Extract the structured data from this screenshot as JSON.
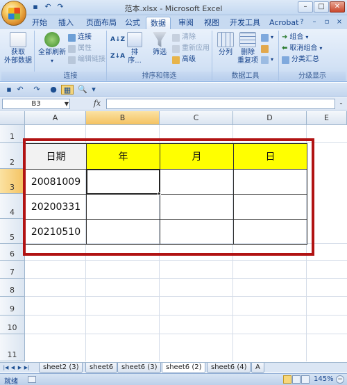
{
  "title": "范本.xlsx - Microsoft Excel",
  "ribbon_tabs": [
    "开始",
    "插入",
    "页面布局",
    "公式",
    "数据",
    "审阅",
    "视图",
    "开发工具",
    "Acrobat"
  ],
  "active_tab": "数据",
  "groups": {
    "get_external": {
      "label": "获取\n外部数据",
      "line1": "获取",
      "line2": "外部数据"
    },
    "connections": {
      "label": "连接",
      "refresh_all": "全部刷新",
      "connections": "连接",
      "properties": "属性",
      "edit_links": "编辑链接"
    },
    "sort_filter": {
      "label": "排序和筛选",
      "sort": "排序...",
      "filter": "筛选",
      "clear": "清除",
      "reapply": "重新应用",
      "advanced": "高级"
    },
    "data_tools": {
      "label": "数据工具",
      "text_to_columns": "分列",
      "remove_dup_1": "删除",
      "remove_dup_2": "重复项"
    },
    "outline": {
      "label": "分级显示",
      "group": "组合",
      "ungroup": "取消组合",
      "subtotal": "分类汇总"
    }
  },
  "name_box": "B3",
  "fx": "fx",
  "columns": [
    "A",
    "B",
    "C",
    "D",
    "E"
  ],
  "rows": [
    "1",
    "2",
    "3",
    "4",
    "5",
    "6",
    "7",
    "8",
    "9",
    "10",
    "11"
  ],
  "table": {
    "header": [
      "日期",
      "年",
      "月",
      "日"
    ],
    "dates": [
      "20081009",
      "20200331",
      "20210510"
    ]
  },
  "sheet_tabs": [
    "sheet2 (3)",
    "sheet6",
    "sheet6 (3)",
    "sheet6 (2)",
    "sheet6 (4)",
    "A"
  ],
  "active_sheet": "sheet6 (2)",
  "status": "就绪",
  "zoom": "145%",
  "colors": {
    "highlight": "#ffff00",
    "annotation": "#b11313",
    "selected_header": "#f4c261"
  }
}
